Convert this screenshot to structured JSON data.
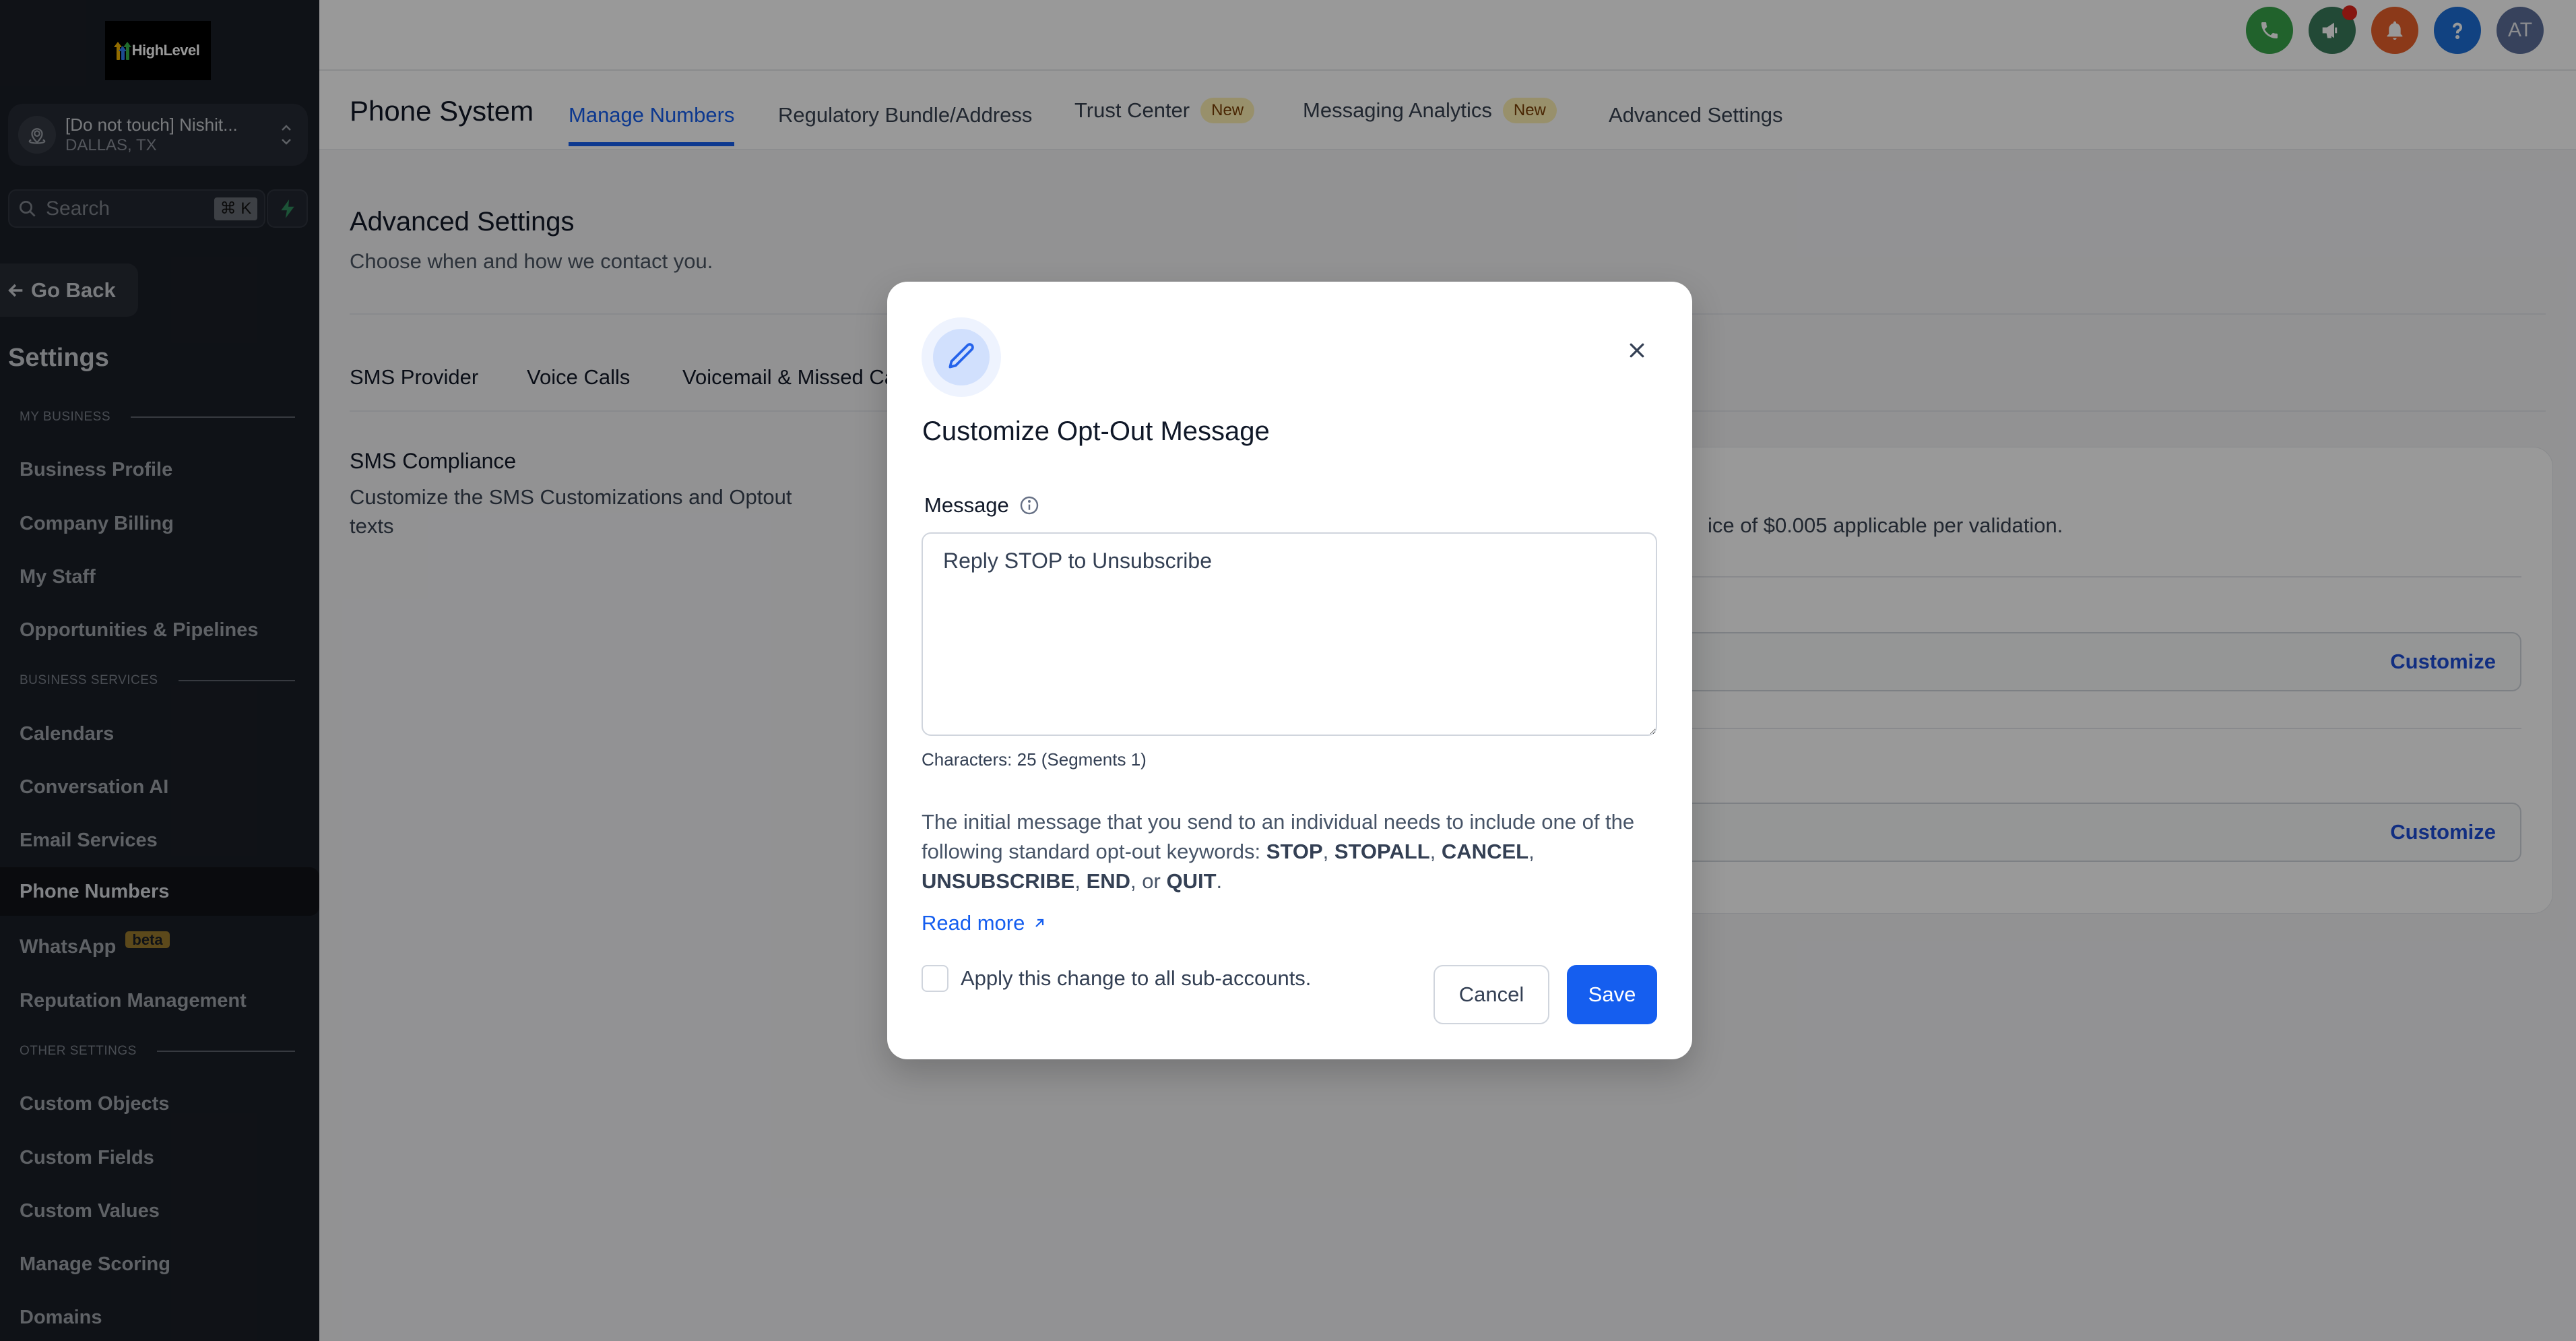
{
  "sidebar": {
    "logo_text": "HighLevel",
    "account": {
      "name": "[Do not touch] Nishit...",
      "location": "DALLAS, TX"
    },
    "search": {
      "placeholder": "Search",
      "shortcut": "⌘ K"
    },
    "go_back_label": "Go Back",
    "title": "Settings",
    "sections": [
      {
        "label": "MY BUSINESS",
        "items": [
          "Business Profile",
          "Company Billing",
          "My Staff",
          "Opportunities & Pipelines"
        ]
      },
      {
        "label": "BUSINESS SERVICES",
        "items": [
          "Calendars",
          "Conversation AI",
          "Email Services",
          "Phone Numbers",
          "WhatsApp",
          "Reputation Management"
        ]
      },
      {
        "label": "OTHER SETTINGS",
        "items": [
          "Custom Objects",
          "Custom Fields",
          "Custom Values",
          "Manage Scoring",
          "Domains"
        ]
      }
    ],
    "active_item": "Phone Numbers",
    "whatsapp_badge": "beta"
  },
  "topbar": {
    "icons": [
      {
        "name": "phone-icon",
        "color": "#37a34a"
      },
      {
        "name": "megaphone-icon",
        "color": "#3a7a5b",
        "has_notification": true
      },
      {
        "name": "bell-icon",
        "color": "#e8602a"
      },
      {
        "name": "help-icon",
        "color": "#1d6fd8"
      },
      {
        "name": "user-avatar",
        "color": "#5d6f9a",
        "initials": "AT"
      }
    ]
  },
  "navbar": {
    "title": "Phone System",
    "tabs": [
      {
        "label": "Manage Numbers",
        "active": true
      },
      {
        "label": "Regulatory Bundle/Address"
      },
      {
        "label": "Trust Center",
        "badge": "New"
      },
      {
        "label": "Messaging Analytics",
        "badge": "New"
      },
      {
        "label": "Advanced Settings"
      }
    ]
  },
  "content": {
    "title": "Advanced Settings",
    "subtitle": "Choose when and how we contact you.",
    "sub_tabs": [
      "SMS Provider",
      "Voice Calls",
      "Voicemail & Missed Ca"
    ],
    "compliance": {
      "title": "SMS Compliance",
      "description": "Customize the SMS Customizations and Optout texts"
    },
    "card": {
      "note": "ice of $0.005 applicable per validation.",
      "customize_label": "Customize"
    }
  },
  "modal": {
    "title": "Customize Opt-Out Message",
    "message_label": "Message",
    "message_value": "Reply STOP to Unsubscribe",
    "char_count": "Characters: 25 (Segments 1)",
    "help_prefix": "The initial message that you send to an individual needs to include one of the following standard opt-out keywords: ",
    "keywords": [
      "STOP",
      "STOPALL",
      "CANCEL",
      "UNSUBSCRIBE",
      "END",
      "QUIT"
    ],
    "read_more": "Read more",
    "apply_all_label": "Apply this change to all sub-accounts.",
    "apply_all_checked": false,
    "cancel_label": "Cancel",
    "save_label": "Save"
  },
  "colors": {
    "primary": "#155eef",
    "sidebar_bg": "#1a1e27",
    "badge_new_bg": "#fdf1b2",
    "badge_beta_bg": "#9a7b2e"
  }
}
